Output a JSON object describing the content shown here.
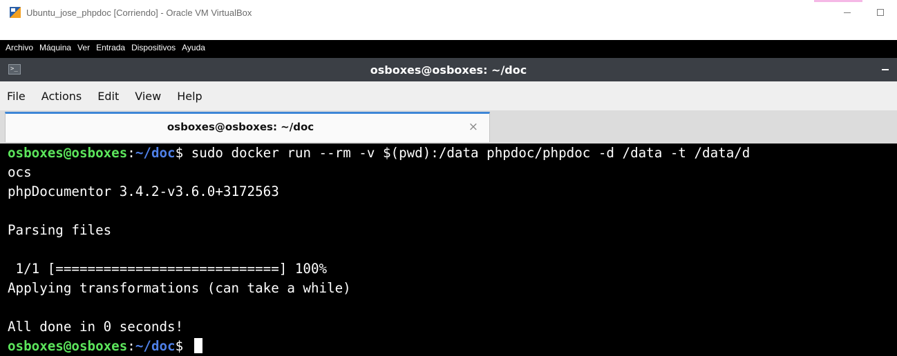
{
  "vbox": {
    "title": "Ubuntu_jose_phpdoc [Corriendo] - Oracle VM VirtualBox",
    "menu": [
      "Archivo",
      "Máquina",
      "Ver",
      "Entrada",
      "Dispositivos",
      "Ayuda"
    ]
  },
  "terminal_window": {
    "title": "osboxes@osboxes: ~/doc",
    "menu": [
      "File",
      "Actions",
      "Edit",
      "View",
      "Help"
    ],
    "tab_label": "osboxes@osboxes: ~/doc",
    "tab_close": "×"
  },
  "prompt": {
    "user_host": "osboxes@osboxes",
    "sep": ":",
    "path": "~/doc",
    "symbol": "$ "
  },
  "output": {
    "command": "sudo docker run --rm -v $(pwd):/data phpdoc/phpdoc -d /data -t /data/d",
    "wrap": "ocs",
    "version": "phpDocumentor 3.4.2-v3.6.0+3172563",
    "parsing": "Parsing files",
    "progress": " 1/1 [============================] 100%",
    "transform": "Applying transformations (can take a while)",
    "done": "All done in 0 seconds!"
  },
  "colors": {
    "prompt_user": "#5ce65c",
    "prompt_path": "#4f80e8",
    "tab_accent": "#3d86d6",
    "titlebar": "#3b3f45"
  }
}
